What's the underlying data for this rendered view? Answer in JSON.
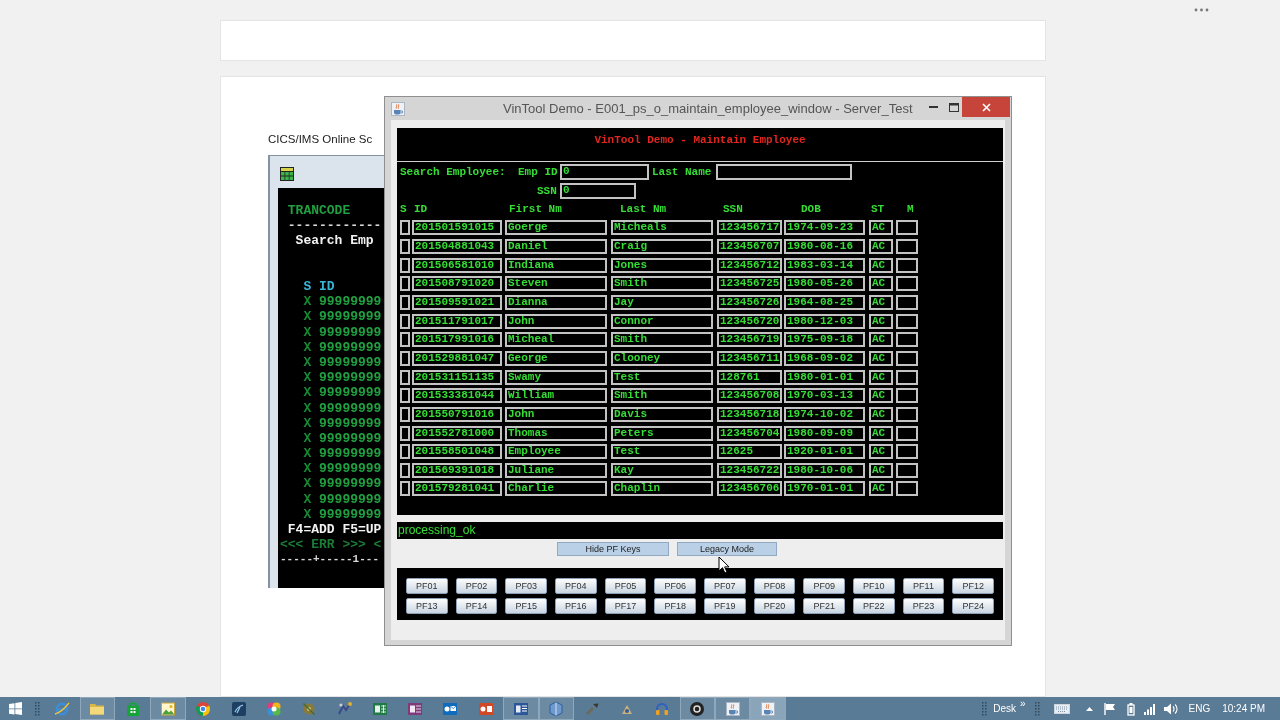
{
  "page": {
    "caption": "CICS/IMS Online Sc"
  },
  "background_window": {
    "lines": [
      {
        "kind": "title",
        "text": "TRANCODE"
      },
      {
        "kind": "divider",
        "text": "------------"
      },
      {
        "kind": "heading",
        "text": "Search Emp"
      }
    ],
    "columns": [
      "S",
      "ID"
    ],
    "rows": [
      {
        "select": "X",
        "id": "99999999"
      },
      {
        "select": "X",
        "id": "99999999"
      },
      {
        "select": "X",
        "id": "99999999"
      },
      {
        "select": "X",
        "id": "99999999"
      },
      {
        "select": "X",
        "id": "99999999"
      },
      {
        "select": "X",
        "id": "99999999"
      },
      {
        "select": "X",
        "id": "99999999"
      },
      {
        "select": "X",
        "id": "99999999"
      },
      {
        "select": "X",
        "id": "99999999"
      },
      {
        "select": "X",
        "id": "99999999"
      },
      {
        "select": "X",
        "id": "99999999"
      },
      {
        "select": "X",
        "id": "99999999"
      },
      {
        "select": "X",
        "id": "99999999"
      },
      {
        "select": "X",
        "id": "99999999"
      },
      {
        "select": "X",
        "id": "99999999"
      }
    ],
    "footer": [
      {
        "kind": "keys",
        "text": "F4=ADD F5=UP"
      },
      {
        "kind": "message",
        "text": "<<< ERR >>> <"
      },
      {
        "kind": "ruler",
        "text": "-----+-----1---"
      }
    ]
  },
  "window": {
    "title": "VinTool Demo - E001_ps_o_maintain_employee_window - Server_Test"
  },
  "screen": {
    "heading": "VinTool Demo - Maintain Employee",
    "search": {
      "label": "Search Employee:",
      "fields": [
        {
          "label": "Emp ID",
          "value": "0"
        },
        {
          "label": "Last Name"
        },
        {
          "label": "SSN",
          "value": "0"
        }
      ]
    },
    "table": {
      "columns": [
        "S",
        "ID",
        "First Nm",
        "Last Nm",
        "SSN",
        "DOB",
        "ST",
        "M"
      ],
      "rows": [
        {
          "id": "201501591015",
          "first_name": "Goerge",
          "last_name": "Micheals",
          "ssn": "123456717",
          "dob": "1974-09-23",
          "st": "AC"
        },
        {
          "id": "201504881043",
          "first_name": "Daniel",
          "last_name": "Craig",
          "ssn": "123456707",
          "dob": "1980-08-16",
          "st": "AC"
        },
        {
          "id": "201506581010",
          "first_name": "Indiana",
          "last_name": "Jones",
          "ssn": "123456712",
          "dob": "1983-03-14",
          "st": "AC"
        },
        {
          "id": "201508791020",
          "first_name": "Steven",
          "last_name": "Smith",
          "ssn": "123456725",
          "dob": "1980-05-26",
          "st": "AC"
        },
        {
          "id": "201509591021",
          "first_name": "Dianna",
          "last_name": "Jay",
          "ssn": "123456726",
          "dob": "1964-08-25",
          "st": "AC"
        },
        {
          "id": "201511791017",
          "first_name": "John",
          "last_name": "Connor",
          "ssn": "123456720",
          "dob": "1980-12-03",
          "st": "AC"
        },
        {
          "id": "201517991016",
          "first_name": "Micheal",
          "last_name": "Smith",
          "ssn": "123456719",
          "dob": "1975-09-18",
          "st": "AC"
        },
        {
          "id": "201529881047",
          "first_name": "George",
          "last_name": "Clooney",
          "ssn": "123456711",
          "dob": "1968-09-02",
          "st": "AC"
        },
        {
          "id": "201531151135",
          "first_name": "Swamy",
          "last_name": "Test",
          "ssn": "128761",
          "dob": "1980-01-01",
          "st": "AC"
        },
        {
          "id": "201533381044",
          "first_name": "William",
          "last_name": "Smith",
          "ssn": "123456708",
          "dob": "1970-03-13",
          "st": "AC"
        },
        {
          "id": "201550791016",
          "first_name": "John",
          "last_name": "Davis",
          "ssn": "123456718",
          "dob": "1974-10-02",
          "st": "AC"
        },
        {
          "id": "201552781000",
          "first_name": "Thomas",
          "last_name": "Peters",
          "ssn": "123456704",
          "dob": "1980-09-09",
          "st": "AC"
        },
        {
          "id": "201558501048",
          "first_name": "Employee",
          "last_name": "Test",
          "ssn": "12625",
          "dob": "1920-01-01",
          "st": "AC"
        },
        {
          "id": "201569391018",
          "first_name": "Juliane",
          "last_name": "Kay",
          "ssn": "123456722",
          "dob": "1980-10-06",
          "st": "AC"
        },
        {
          "id": "201579281041",
          "first_name": "Charlie",
          "last_name": "Chaplin",
          "ssn": "123456706",
          "dob": "1970-01-01",
          "st": "AC"
        }
      ]
    }
  },
  "status": "processing_ok",
  "buttons": [
    "Hide PF Keys",
    "Legacy Mode"
  ],
  "pf_keys": [
    "PF01",
    "PF02",
    "PF03",
    "PF04",
    "PF05",
    "PF06",
    "PF07",
    "PF08",
    "PF09",
    "PF10",
    "PF11",
    "PF12",
    "PF13",
    "PF14",
    "PF15",
    "PF16",
    "PF17",
    "PF18",
    "PF19",
    "PF20",
    "PF21",
    "PF22",
    "PF23",
    "PF24"
  ],
  "taskbar": {
    "apps": [
      {
        "open": false,
        "selected": false
      },
      {
        "open": true,
        "selected": false
      },
      {
        "open": false,
        "selected": false
      },
      {
        "open": true,
        "selected": false
      },
      {
        "open": false,
        "selected": false
      },
      {
        "open": false,
        "selected": false
      },
      {
        "open": false,
        "selected": false
      },
      {
        "open": false,
        "selected": false
      },
      {
        "open": false,
        "selected": false
      },
      {
        "open": false,
        "selected": false
      },
      {
        "open": false,
        "selected": false
      },
      {
        "open": false,
        "selected": false
      },
      {
        "open": false,
        "selected": false
      },
      {
        "open": true,
        "selected": false
      },
      {
        "open": true,
        "selected": false
      },
      {
        "open": false,
        "selected": false
      },
      {
        "open": false,
        "selected": false
      },
      {
        "open": false,
        "selected": false
      },
      {
        "open": true,
        "selected": false
      },
      {
        "open": true,
        "selected": false
      },
      {
        "open": true,
        "selected": true
      }
    ]
  },
  "tray": {
    "toolbar": "Desk",
    "chevron": "»",
    "language": "ENG",
    "clock": "10:24 PM"
  }
}
